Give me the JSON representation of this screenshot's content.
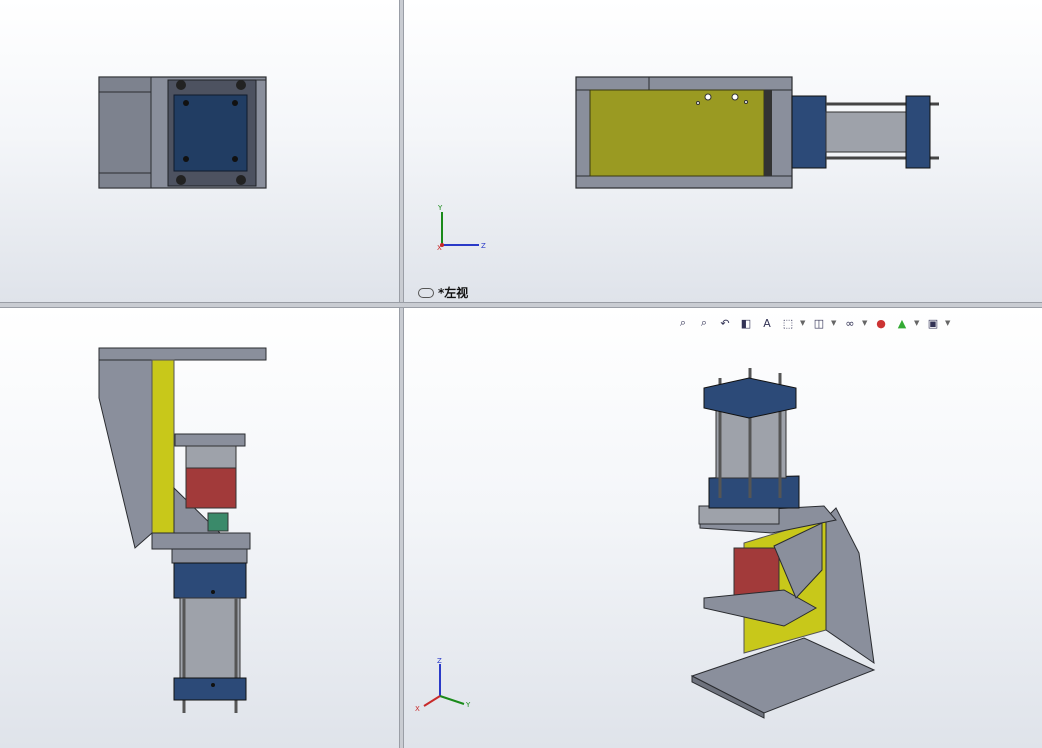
{
  "views": {
    "top_left": {
      "name": "top"
    },
    "top_right": {
      "name": "front"
    },
    "bottom_left": {
      "name": "left"
    },
    "bottom_right": {
      "name": "isometric"
    }
  },
  "active_view_label": "*左视",
  "axes": {
    "x": "X",
    "y": "Y",
    "z": "Z"
  },
  "heads_up_toolbar": [
    {
      "icon": "zoom-to-fit-icon",
      "glyph": "⌕"
    },
    {
      "icon": "zoom-to-area-icon",
      "glyph": "⌕"
    },
    {
      "icon": "previous-view-icon",
      "glyph": "↶"
    },
    {
      "icon": "section-view-icon",
      "glyph": "◧"
    },
    {
      "icon": "dynamic-annotation-icon",
      "glyph": "A"
    },
    {
      "icon": "view-orientation-icon",
      "glyph": "⬚",
      "dropdown": true
    },
    {
      "icon": "display-style-icon",
      "glyph": "◫",
      "dropdown": true
    },
    {
      "icon": "hide-show-items-icon",
      "glyph": "👓",
      "dropdown": true
    },
    {
      "icon": "edit-appearance-icon",
      "glyph": "●"
    },
    {
      "icon": "apply-scene-icon",
      "glyph": "▲",
      "dropdown": true
    },
    {
      "icon": "view-settings-icon",
      "glyph": "▣",
      "dropdown": true
    }
  ],
  "colors": {
    "steel": "#8a8f9c",
    "steel_dark": "#4b4f59",
    "yellow_plate": "#c8c81a",
    "blue_block": "#2c4a78",
    "red_cylinder": "#a23a3a",
    "rod": "#9ea2aa"
  }
}
